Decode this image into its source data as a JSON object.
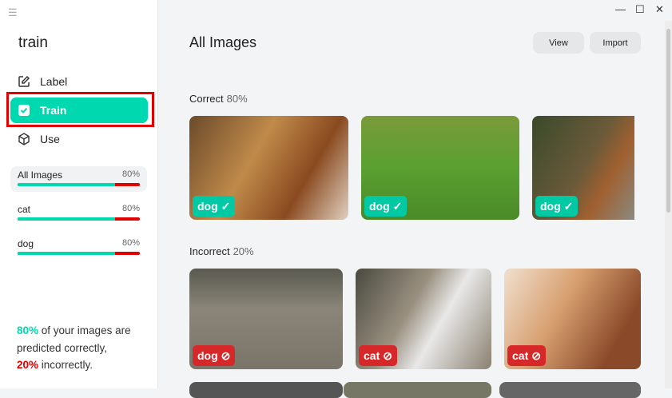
{
  "window": {
    "minimize": "—",
    "maximize": "☐",
    "close": "✕"
  },
  "sidebar": {
    "title": "train",
    "nav": [
      {
        "label": "Label",
        "icon": "edit-icon"
      },
      {
        "label": "Train",
        "icon": "checkbox-icon"
      },
      {
        "label": "Use",
        "icon": "cube-icon"
      }
    ],
    "stats": [
      {
        "label": "All Images",
        "value": "80%",
        "fraction": 0.8
      },
      {
        "label": "cat",
        "value": "80%",
        "fraction": 0.8
      },
      {
        "label": "dog",
        "value": "80%",
        "fraction": 0.8
      }
    ],
    "summary": {
      "correct_pct": "80%",
      "text1": " of your images are predicted correctly,",
      "incorrect_pct": "20%",
      "text2": " incorrectly."
    }
  },
  "main": {
    "title": "All Images",
    "view_label": "View",
    "import_label": "Import",
    "correct": {
      "label": "Correct",
      "pct": "80%",
      "items": [
        {
          "tag": "dog"
        },
        {
          "tag": "dog"
        },
        {
          "tag": "dog"
        }
      ]
    },
    "incorrect": {
      "label": "Incorrect",
      "pct": "20%",
      "items": [
        {
          "tag": "dog"
        },
        {
          "tag": "cat"
        },
        {
          "tag": "cat"
        }
      ]
    }
  },
  "colors": {
    "accent": "#00d9b0",
    "error": "#e00000"
  }
}
